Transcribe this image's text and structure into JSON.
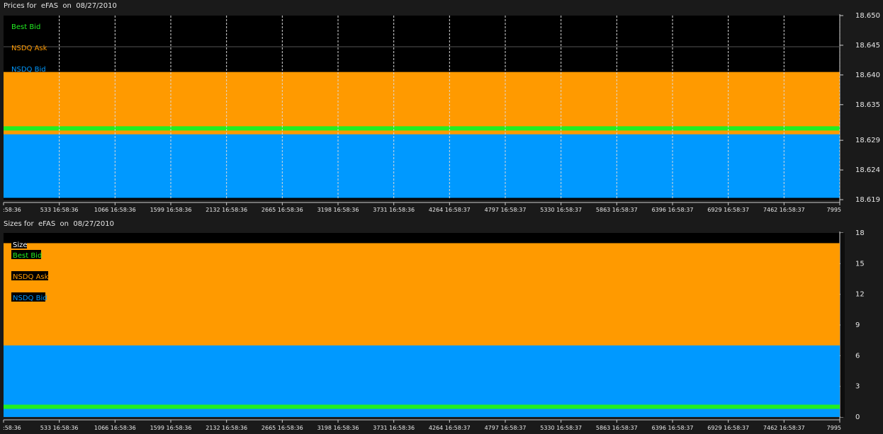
{
  "prices_panel": {
    "title": "Prices for  eFAS  on  08/27/2010"
  },
  "sizes_panel": {
    "title": "Sizes for  eFAS  on  08/27/2010"
  },
  "colors": {
    "best_bid": "#22ee22",
    "nsdq_ask": "#ff9a00",
    "nsdq_bid": "#0099ff",
    "plot_bg": "#000000",
    "axis_text": "#e8e8e8"
  },
  "chart_data": [
    {
      "type": "area",
      "title": "Prices for  eFAS  on  08/27/2010",
      "x_tick_labels": [
        ":58:36",
        "533 16:58:36",
        "1066 16:58:36",
        "1599 16:58:36",
        "2132 16:58:36",
        "2665 16:58:36",
        "3198 16:58:36",
        "3731 16:58:36",
        "4264 16:58:37",
        "4797 16:58:37",
        "5330 16:58:37",
        "5863 16:58:37",
        "6396 16:58:37",
        "6929 16:58:37",
        "7462 16:58:37",
        "7995"
      ],
      "x_ticks": [
        0,
        533,
        1066,
        1599,
        2132,
        2665,
        3198,
        3731,
        4264,
        4797,
        5330,
        5863,
        6396,
        6929,
        7462,
        7995
      ],
      "xlim": [
        0,
        7995
      ],
      "y_tick_labels": [
        "18.650",
        "18.645",
        "18.640",
        "18.635",
        "18.629",
        "18.624",
        "18.619"
      ],
      "ylim": [
        18.619,
        18.65
      ],
      "grid": "vertical dashed",
      "legend": [
        "Best Bid",
        "NSDQ Ask",
        "NSDQ Bid"
      ],
      "series": [
        {
          "name": "NSDQ Ask",
          "value": 18.6405
        },
        {
          "name": "Best Bid",
          "value": 18.631
        },
        {
          "name": "NSDQ Bid",
          "value": 18.63
        }
      ]
    },
    {
      "type": "area",
      "title": "Sizes for  eFAS  on  08/27/2010",
      "x_tick_labels": [
        ":58:36",
        "533 16:58:36",
        "1066 16:58:36",
        "1599 16:58:36",
        "2132 16:58:36",
        "2665 16:58:36",
        "3198 16:58:36",
        "3731 16:58:36",
        "4264 16:58:37",
        "4797 16:58:37",
        "5330 16:58:37",
        "5863 16:58:37",
        "6396 16:58:37",
        "6929 16:58:37",
        "7462 16:58:37",
        "7995"
      ],
      "x_ticks": [
        0,
        533,
        1066,
        1599,
        2132,
        2665,
        3198,
        3731,
        4264,
        4797,
        5330,
        5863,
        6396,
        6929,
        7462,
        7995
      ],
      "xlim": [
        0,
        7995
      ],
      "y_tick_labels": [
        "18",
        "15",
        "12",
        "9",
        "6",
        "3",
        "0"
      ],
      "ylim": [
        0,
        18
      ],
      "legend_header": "Size",
      "legend": [
        "Best Bid",
        "NSDQ Ask",
        "NSDQ Bid"
      ],
      "series": [
        {
          "name": "NSDQ Ask",
          "value": 17
        },
        {
          "name": "NSDQ Bid",
          "value": 7
        },
        {
          "name": "Best Bid",
          "value": 1
        }
      ]
    }
  ]
}
